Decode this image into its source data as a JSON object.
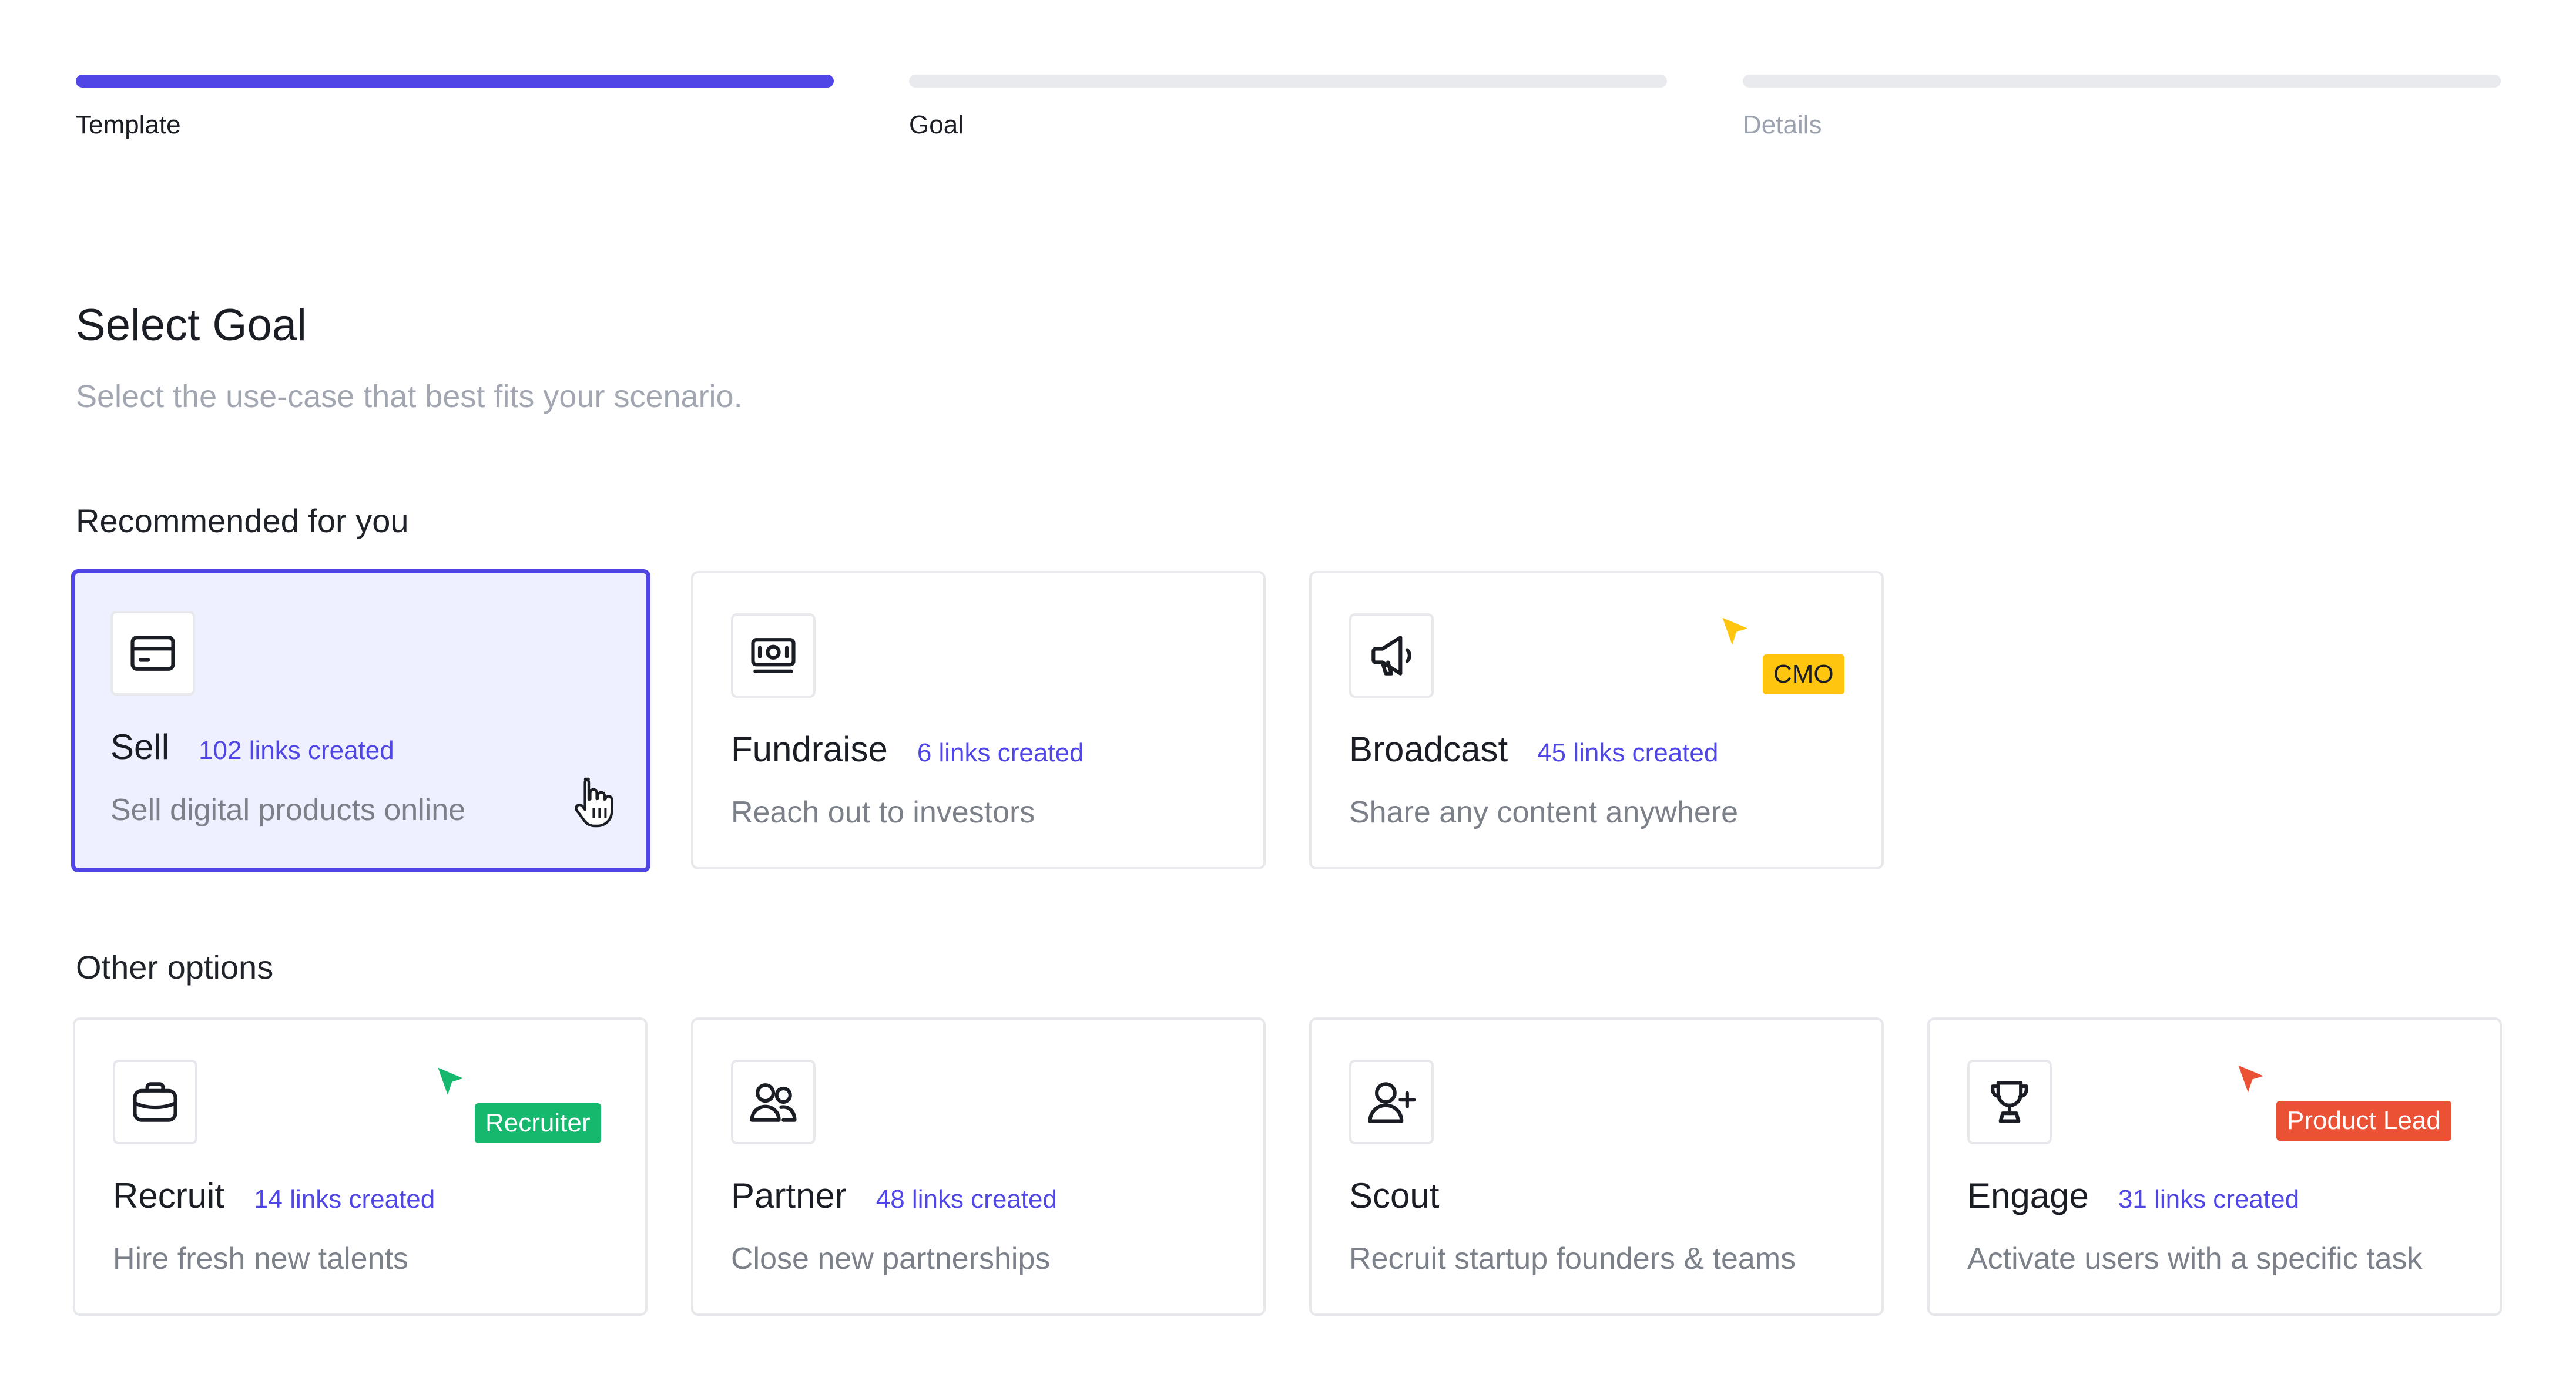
{
  "stepper": {
    "steps": [
      {
        "label": "Template",
        "state": "completed"
      },
      {
        "label": "Goal",
        "state": "current"
      },
      {
        "label": "Details",
        "state": "upcoming"
      }
    ],
    "colors": {
      "active": "#4f46e5",
      "inactive": "#e8eaee"
    }
  },
  "header": {
    "title": "Select Goal",
    "subtitle": "Select the use-case that best fits your scenario."
  },
  "recommended": {
    "label": "Recommended for you",
    "cards": [
      {
        "name": "Sell",
        "count": "102 links created",
        "description": "Sell digital products online",
        "icon": "credit-card-icon",
        "selected": true
      },
      {
        "name": "Fundraise",
        "count": "6 links created",
        "description": "Reach out to investors",
        "icon": "banknote-icon",
        "selected": false
      },
      {
        "name": "Broadcast",
        "count": "45 links created",
        "description": "Share any content anywhere",
        "icon": "megaphone-icon",
        "selected": false
      }
    ]
  },
  "other": {
    "label": "Other options",
    "cards": [
      {
        "name": "Recruit",
        "count": "14 links created",
        "description": "Hire fresh new talents",
        "icon": "briefcase-icon"
      },
      {
        "name": "Partner",
        "count": "48 links created",
        "description": "Close new partnerships",
        "icon": "users-icon"
      },
      {
        "name": "Scout",
        "count": "",
        "description": "Recruit startup founders & teams",
        "icon": "user-plus-icon"
      },
      {
        "name": "Engage",
        "count": "31 links created",
        "description": "Activate users with a specific task",
        "icon": "trophy-icon"
      }
    ]
  },
  "cursors": {
    "cmo": {
      "label": "CMO",
      "color": "#ffc50f"
    },
    "recruiter": {
      "label": "Recruiter",
      "color": "#16b86e"
    },
    "product_lead": {
      "label": "Product Lead",
      "color": "#eb5134"
    }
  },
  "accent": "#4f46e5"
}
